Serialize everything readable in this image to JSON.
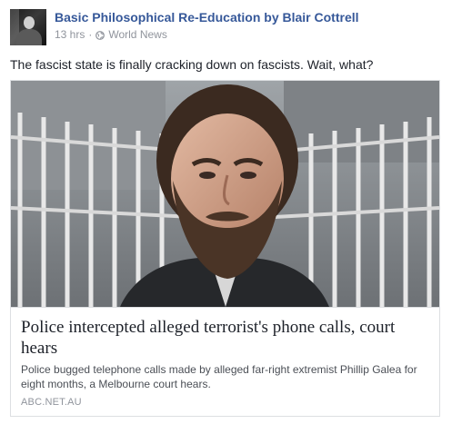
{
  "post": {
    "page_name": "Basic Philosophical Re-Education by Blair Cottrell",
    "time": "13 hrs",
    "separator": "·",
    "privacy_icon": "globe-icon",
    "category": "World News",
    "text": "The fascist state is finally cracking down on fascists. Wait, what?"
  },
  "link_card": {
    "image_icon": "news-photo",
    "headline": "Police intercepted alleged terrorist's phone calls, court hears",
    "description": "Police bugged telephone calls made by alleged far-right extremist Phillip Galea for eight months, a Melbourne court hears.",
    "domain": "ABC.NET.AU"
  },
  "colors": {
    "link": "#365899",
    "meta": "#90949c",
    "text": "#1d2129",
    "border": "#dddfe2"
  }
}
